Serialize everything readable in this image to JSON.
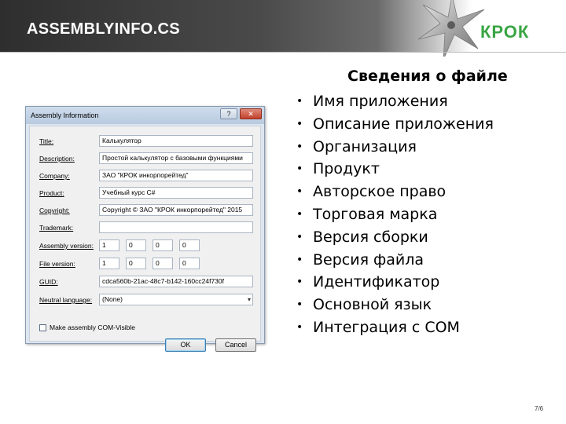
{
  "header": {
    "title": "ASSEMBLYINFO.CS",
    "logo_text": "КРОК",
    "logo_color": "#3aa544"
  },
  "dialog": {
    "title": "Assembly Information",
    "help_label": "?",
    "close_label": "✕",
    "fields": [
      {
        "label": "Title:",
        "value": "Калькулятор"
      },
      {
        "label": "Description:",
        "value": "Простой калькулятор с базовыми функциями"
      },
      {
        "label": "Company:",
        "value": "ЗАО \"КРОК инкорпорейтед\""
      },
      {
        "label": "Product:",
        "value": "Учебный курс C#"
      },
      {
        "label": "Copyright:",
        "value": "Copyright © ЗАО \"КРОК инкорпорейтед\" 2015"
      },
      {
        "label": "Trademark:",
        "value": ""
      }
    ],
    "assembly_version": {
      "label": "Assembly version:",
      "parts": [
        "1",
        "0",
        "0",
        "0"
      ]
    },
    "file_version": {
      "label": "File version:",
      "parts": [
        "1",
        "0",
        "0",
        "0"
      ]
    },
    "guid": {
      "label": "GUID:",
      "value": "cdca560b-21ac-48c7-b142-160cc24f730f"
    },
    "neutral_language": {
      "label": "Neutral language:",
      "value": "(None)"
    },
    "com_visible": {
      "label": "Make assembly COM-Visible",
      "checked": false
    },
    "ok_label": "OK",
    "cancel_label": "Cancel"
  },
  "info": {
    "title": "Сведения о файле",
    "bullet_glyph": "•",
    "items": [
      "Имя приложения",
      "Описание приложения",
      "Организация",
      "Продукт",
      "Авторское право",
      "Торговая марка",
      "Версия сборки",
      "Версия файла",
      "Идентификатор",
      "Основной язык",
      "Интеграция с COM"
    ]
  },
  "page_number": "7/6"
}
